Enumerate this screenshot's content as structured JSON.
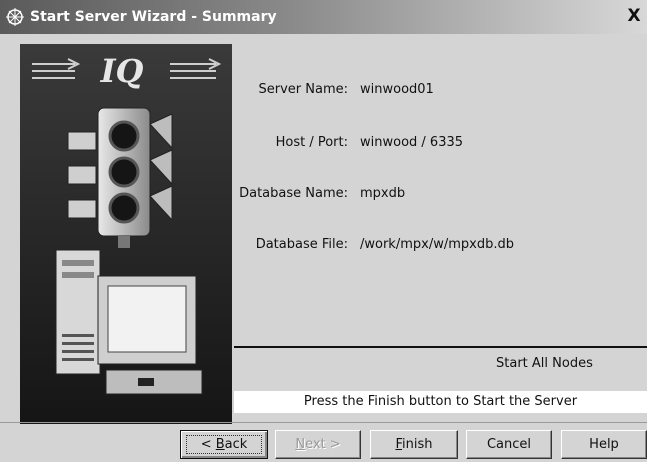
{
  "window": {
    "title": "Start Server Wizard - Summary",
    "icon": "wizard-app-icon",
    "close_label": "X"
  },
  "art": {
    "logo_text": "IQ",
    "icons": [
      "traffic-light-icon",
      "computer-icon"
    ]
  },
  "summary": {
    "fields": [
      {
        "label": "Server Name:",
        "value": "winwood01"
      },
      {
        "label": "Host / Port:",
        "value": "winwood / 6335"
      },
      {
        "label": "Database Name:",
        "value": "mpxdb"
      },
      {
        "label": "Database File:",
        "value": "/work/mpx/w/mpxdb.db"
      }
    ],
    "start_all_nodes": "Start All Nodes",
    "status": "Press the Finish button to Start the Server"
  },
  "buttons": {
    "back": {
      "pre": "< ",
      "key": "B",
      "post": "ack"
    },
    "next": {
      "key": "N",
      "post": "ext >"
    },
    "finish": {
      "key": "F",
      "post": "inish"
    },
    "cancel": "Cancel",
    "help": "Help"
  }
}
